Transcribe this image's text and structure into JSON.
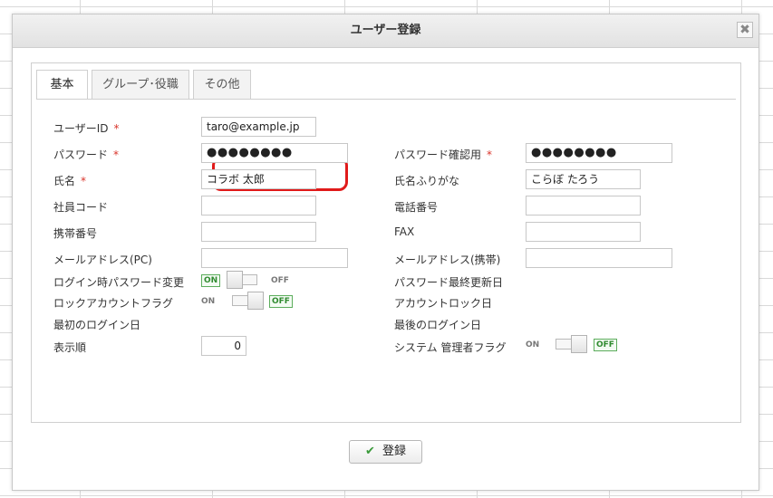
{
  "dialog": {
    "title": "ユーザー登録",
    "close_glyph": "✖",
    "save_label": "登録",
    "save_icon": "check-icon"
  },
  "tabs": [
    {
      "label": "基本",
      "active": true
    },
    {
      "label": "グループ･役職",
      "active": false
    },
    {
      "label": "その他",
      "active": false
    }
  ],
  "required_mark": "*",
  "left": {
    "user_id": {
      "label": "ユーザーID",
      "value": "taro@example.jp"
    },
    "password": {
      "label": "パスワード",
      "value": "●●●●●●●●"
    },
    "name": {
      "label": "氏名",
      "value": "コラボ 太郎"
    },
    "employee_code": {
      "label": "社員コード",
      "value": ""
    },
    "mobile": {
      "label": "携帯番号",
      "value": ""
    },
    "email_pc": {
      "label": "メールアドレス(PC)",
      "value": ""
    },
    "pw_change_on_login": {
      "label": "ログイン時パスワード変更",
      "on": "ON",
      "off": "OFF",
      "state": "ON"
    },
    "lock_account": {
      "label": "ロックアカウントフラグ",
      "on": "ON",
      "off": "OFF",
      "state": "OFF"
    },
    "first_login": {
      "label": "最初のログイン日"
    },
    "display_order": {
      "label": "表示順",
      "value": "0"
    }
  },
  "right": {
    "password_confirm": {
      "label": "パスワード確認用",
      "value": "●●●●●●●●"
    },
    "name_kana": {
      "label": "氏名ふりがな",
      "value": "こらぼ たろう"
    },
    "phone": {
      "label": "電話番号",
      "value": ""
    },
    "fax": {
      "label": "FAX",
      "value": ""
    },
    "email_mobile": {
      "label": "メールアドレス(携帯)",
      "value": ""
    },
    "pw_last_updated": {
      "label": "パスワード最終更新日"
    },
    "account_lock_date": {
      "label": "アカウントロック日"
    },
    "last_login": {
      "label": "最後のログイン日"
    },
    "sysadmin_flag": {
      "label": "システム 管理者フラグ",
      "on": "ON",
      "off": "OFF",
      "state": "OFF"
    }
  },
  "colors": {
    "required": "#d9342b",
    "highlight": "#e01a1a",
    "toggle_active": "#2f8a2f"
  }
}
